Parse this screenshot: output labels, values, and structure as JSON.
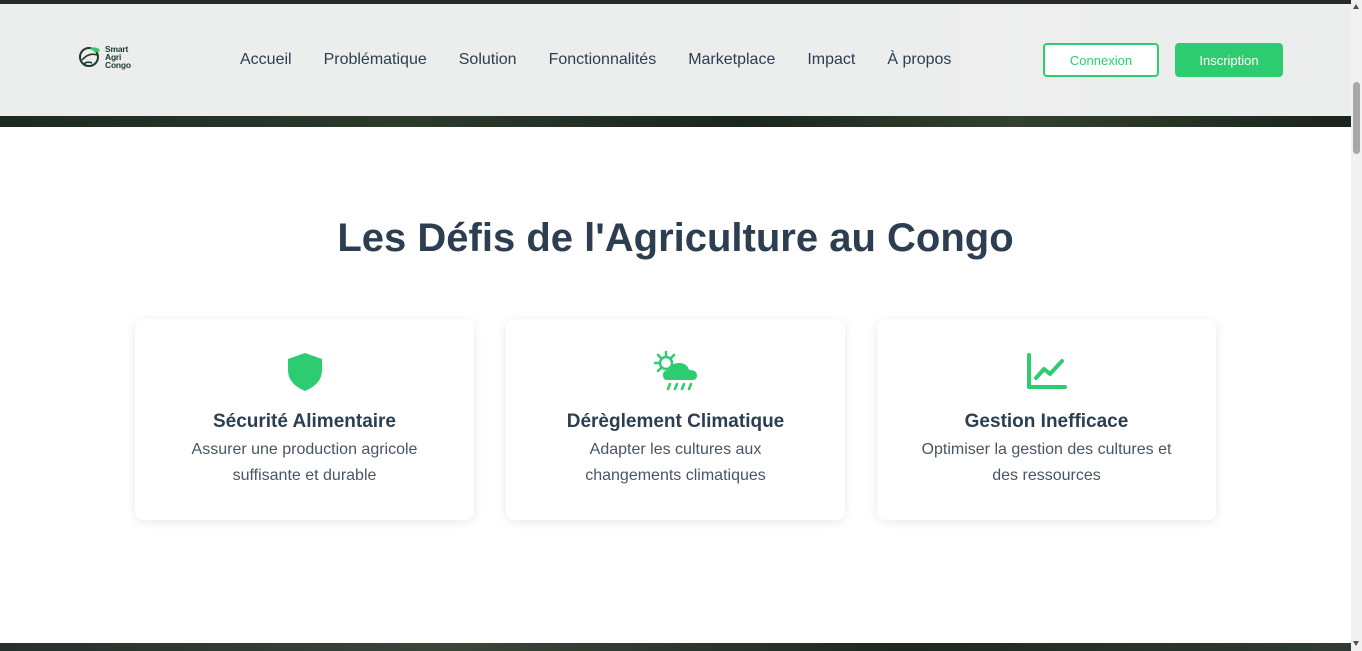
{
  "brand": {
    "logo_lines": [
      "Smart",
      "Agri",
      "Congo"
    ],
    "logo_icon": "leaf-globe-icon",
    "accent_color": "#2ecc71",
    "heading_color": "#2c3e50"
  },
  "nav": {
    "items": [
      {
        "label": "Accueil"
      },
      {
        "label": "Problématique"
      },
      {
        "label": "Solution"
      },
      {
        "label": "Fonctionnalités"
      },
      {
        "label": "Marketplace"
      },
      {
        "label": "Impact"
      },
      {
        "label": "À propos"
      }
    ],
    "login_label": "Connexion",
    "signup_label": "Inscription"
  },
  "section": {
    "title": "Les Défis de l'Agriculture au Congo",
    "cards": [
      {
        "icon": "shield-icon",
        "title": "Sécurité Alimentaire",
        "description": "Assurer une production agricole suffisante et durable"
      },
      {
        "icon": "sun-rain-cloud-icon",
        "title": "Dérèglement Climatique",
        "description": "Adapter les cultures aux changements climatiques"
      },
      {
        "icon": "line-chart-icon",
        "title": "Gestion Inefficace",
        "description": "Optimiser la gestion des cultures et des ressources"
      }
    ]
  }
}
